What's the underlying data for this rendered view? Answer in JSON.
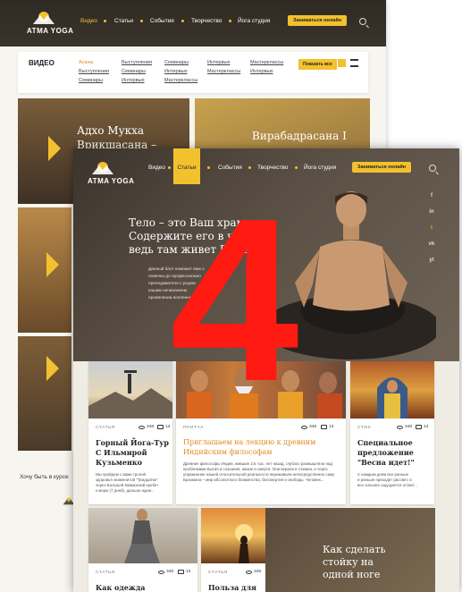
{
  "overlay_number": "4",
  "back": {
    "logo": "ATMA YOGA",
    "nav": [
      "Видео",
      "Статьи",
      "События",
      "Творчество",
      "Йога студия"
    ],
    "nav_active_index": 0,
    "cta": "Заниматься онлайн",
    "filter": {
      "title": "ВИДЕО",
      "columns": [
        [
          "Асаны",
          "Выступления",
          "Семинары"
        ],
        [
          "Выступления",
          "Семинары",
          "Интервью"
        ],
        [
          "Семинары",
          "Интервью",
          "Мастерклассы"
        ],
        [
          "Интервью",
          "Мастерклассы"
        ],
        [
          "Мастерклассы",
          "Интервью"
        ]
      ],
      "active": "Асаны",
      "show_all": "Показать все"
    },
    "video_titles": [
      "Адхо Мукха Врикшасана –",
      "Вирабадрасана I"
    ],
    "footer_text": "Хочу быть в курсе"
  },
  "front": {
    "logo": "ATMA YOGA",
    "nav": [
      "Видео",
      "Статьи",
      "События",
      "Творчество",
      "Йога студия"
    ],
    "nav_active_index": 1,
    "cta": "Заниматься онлайн",
    "social": [
      "f",
      "in",
      "t",
      "vk",
      "yt"
    ],
    "hero": {
      "title_lines": [
        "Тело – это Ваш храм.",
        "Содержите его в чистоте,",
        "ведь там живет Ваша"
      ],
      "text_lines": [
        "Данный блог поможет вам о",
        "новичка до профессионал",
        "преподавателя с родом",
        "кашим начинанием",
        "проявлении вселенно"
      ]
    },
    "cards": [
      {
        "category": "СТАТЬЯ",
        "views": "348",
        "comments": "13",
        "title_lines": [
          "Горный Йога-Тур",
          "С Ильмирой",
          "Кузьменко"
        ],
        "text_lines": [
          "Мы пройдем с вами тропой",
          "здоровья знаменитой \"Тридцатки\"",
          "через Большой Кавказский хребет",
          "к морю (7 дней), дальше идем..."
        ]
      },
      {
        "category": "ПРИТЧА",
        "views": "348",
        "comments": "13",
        "title_lines": [
          "Приглашаем на лекцию к древним",
          "Индийским философам"
        ],
        "text_lines": [
          "Древние философы Индии, жившие 2,5 тыс. лет назад, глубоко размышляли над",
          "проблемами Бытия и сознания, жизни и смерти. Они верили в Атмана, и через",
          "упражнение нашей относительной реальности переживали непосредственно саму",
          "Брахмана – мир абсолютного блаженства, бессмертия и свободы. Человек..."
        ]
      },
      {
        "category": "СТИХ",
        "views": "348",
        "comments": "13",
        "title_lines": [
          "Специальное",
          "предложение",
          "\"Весна идет!\""
        ],
        "text_lines": [
          "С каждым днем все раньше",
          "и раньше приходит рассвет, и",
          "все сильнее ощущается отсвет..."
        ]
      }
    ],
    "bottom_cards": [
      {
        "category": "СТАТЬЯ",
        "views": "348",
        "comments": "13",
        "title": "Как одежда"
      },
      {
        "category": "СТАТЬЯ",
        "views": "348",
        "comments": "13",
        "title": "Польза для"
      }
    ],
    "feature_title": [
      "Как сделать",
      "стойку на",
      "одной ноге"
    ]
  }
}
